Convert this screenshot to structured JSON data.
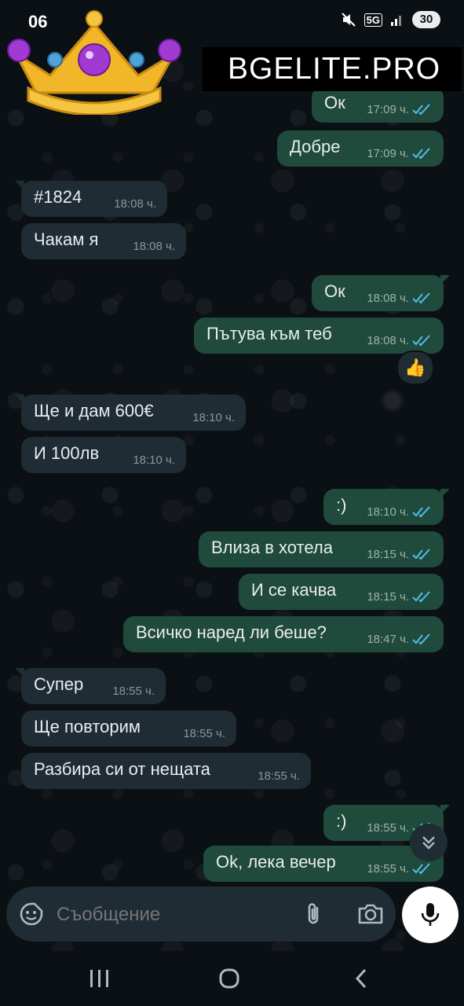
{
  "status_bar": {
    "time": "06",
    "battery": "30",
    "network": "5G"
  },
  "banner": {
    "text": "BGELITE.PRO"
  },
  "messages": [
    {
      "side": "out",
      "text": "Ок",
      "time": "17:09 ч."
    },
    {
      "side": "out",
      "text": "Добре",
      "time": "17:09 ч."
    },
    {
      "side": "in",
      "text": "#1824",
      "time": "18:08 ч."
    },
    {
      "side": "in",
      "text": "Чакам я",
      "time": "18:08 ч."
    },
    {
      "side": "out",
      "text": "Ок",
      "time": "18:08 ч."
    },
    {
      "side": "out",
      "text": "Пътува към теб",
      "time": "18:08 ч."
    },
    {
      "side": "in",
      "text": "Ще и дам 600€",
      "time": "18:10 ч."
    },
    {
      "side": "in",
      "text": "И 100лв",
      "time": "18:10 ч."
    },
    {
      "side": "out",
      "text": ":)",
      "time": "18:10 ч."
    },
    {
      "side": "out",
      "text": "Влиза в хотела",
      "time": "18:15 ч."
    },
    {
      "side": "out",
      "text": "И се качва",
      "time": "18:15 ч."
    },
    {
      "side": "out",
      "text": "Всичко наред ли беше?",
      "time": "18:47 ч."
    },
    {
      "side": "in",
      "text": "Супер",
      "time": "18:55 ч."
    },
    {
      "side": "in",
      "text": "Ще повторим",
      "time": "18:55 ч."
    },
    {
      "side": "in",
      "text": "Разбира си от нещата",
      "time": "18:55 ч."
    },
    {
      "side": "out",
      "text": ":)",
      "time": "18:55 ч."
    },
    {
      "side": "out",
      "text": "Ok, лека вечер",
      "time": "18:55 ч."
    }
  ],
  "reaction": {
    "emoji": "👍"
  },
  "composer": {
    "placeholder": "Съобщение"
  },
  "icons": {
    "emoji": "sticker-smiley-icon",
    "attach": "paperclip-icon",
    "camera": "camera-icon",
    "mic": "microphone-icon",
    "scroll": "double-chevron-down-icon",
    "nav_recent": "recent-apps-icon",
    "nav_home": "home-icon",
    "nav_back": "back-icon"
  },
  "colors": {
    "background": "#0b1014",
    "incoming": "#1f2c34",
    "outgoing": "#1f4a3c",
    "tick": "#53bdeb"
  }
}
